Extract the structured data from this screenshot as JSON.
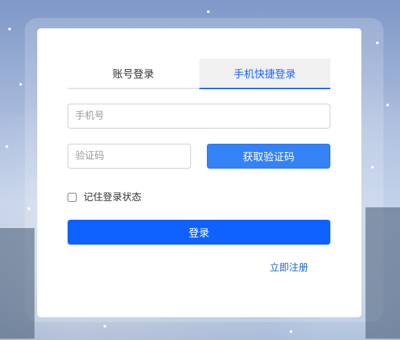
{
  "login": {
    "tabs": [
      {
        "label": "账号登录",
        "active": false
      },
      {
        "label": "手机快捷登录",
        "active": true
      }
    ],
    "phone_placeholder": "手机号",
    "code_placeholder": "验证码",
    "get_code_label": "获取验证码",
    "remember_label": "记住登录状态",
    "remember_checked": false,
    "submit_label": "登录",
    "register_label": "立即注册"
  },
  "colors": {
    "accent": "#1a66ff",
    "button_primary": "#0f62ff",
    "button_code": "#3482f6"
  }
}
